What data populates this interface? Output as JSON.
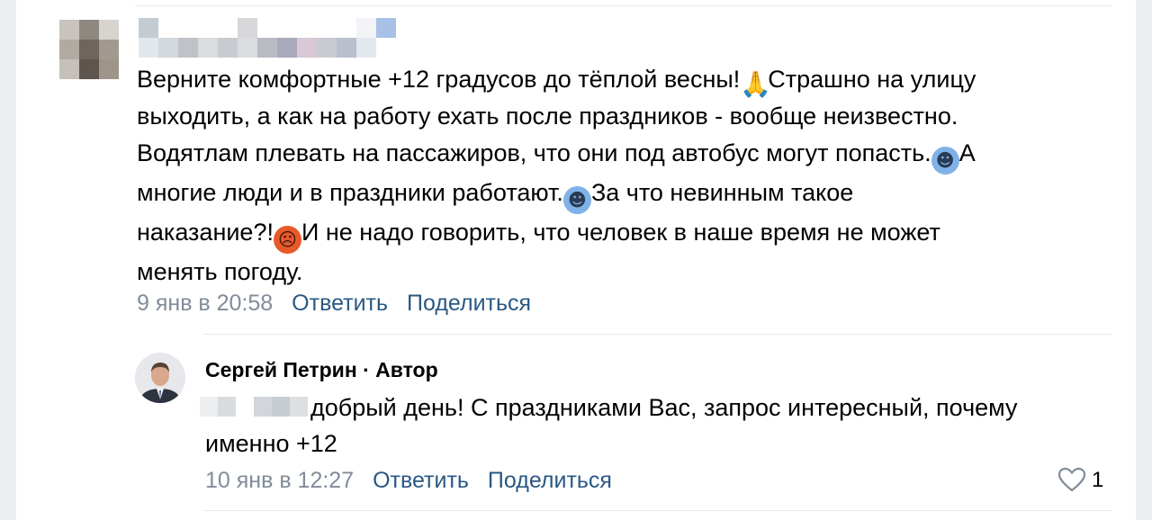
{
  "comment": {
    "text": {
      "line1_a": "Верните комфортные +12 градусов до тёплой весны!",
      "line1_b": "Страшно на улицу",
      "line2": "выходить, а как на работу ехать после праздников - вообще неизвестно.",
      "line3_a": "Водятлам плевать на пассажиров, что они под автобус могут попасть.",
      "line3_b": "А",
      "line4_a": "многие люди и в праздники работают.",
      "line4_b": "За что невинным такое",
      "line5_a": "наказание?!",
      "line5_b": "И не надо говорить, что человек в наше время не может",
      "line6": "менять погоду."
    },
    "emojis": {
      "pray": "praying-hands-emoji",
      "fear1": "fearful-face-emoji",
      "fear2": "fearful-face-emoji",
      "angry": "angry-face-emoji"
    },
    "date": "9 янв в 20:58",
    "reply_label": "Ответить",
    "share_label": "Поделиться"
  },
  "reply": {
    "author": "Сергей Петрин · Автор",
    "text_line1": "добрый день! С праздниками Вас, запрос интересный, почему",
    "text_line2": "именно +12",
    "date": "10 янв в 12:27",
    "reply_label": "Ответить",
    "share_label": "Поделиться",
    "like_icon": "heart-outline-icon",
    "likes": "1"
  },
  "colors": {
    "link": "#2a5885",
    "meta": "#818c99",
    "background": "#ffffff",
    "side": "#edeef0"
  }
}
